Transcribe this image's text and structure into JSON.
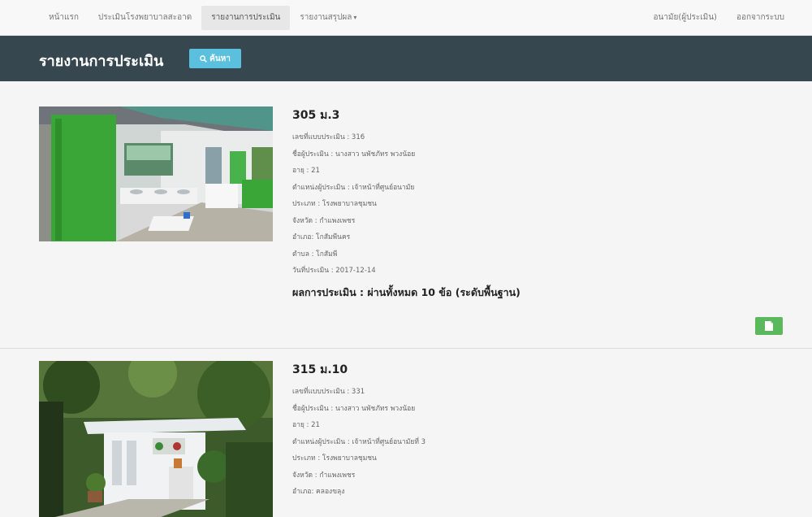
{
  "nav": {
    "home": "หน้าแรก",
    "assess": "ประเมินโรงพยาบาลสะอาด",
    "reports": "รายงานการประเมิน",
    "summary": "รายงานสรุปผล",
    "user": "อนามัย(ผู้ประเมิน)",
    "logout": "ออกจากระบบ"
  },
  "header": {
    "title": "รายงานการประเมิน",
    "search_label": "ค้นหา"
  },
  "records": [
    {
      "title": "305 ม.3",
      "form_no": "เลขที่แบบประเมิน : 316",
      "assessor": "ชื่อผู้ประเมิน : นางสาว นพัชภัทร พวงน้อย",
      "age": "อายุ : 21",
      "position": "ตำแหน่งผู้ประเมิน : เจ้าหน้าที่ศูนย์อนามัย",
      "type": "ประเภท : โรงพยาบาลชุมชน",
      "province": "จังหวัด : กำแพงเพชร",
      "district": "อำเภอ: โกสัมพีนคร",
      "subdistrict": "ตำบล : โกสัมพี",
      "date": "วันที่ประเมิน : 2017-12-14",
      "result": "ผลการประเมิน : ผ่านทั้งหมด 10 ข้อ (ระดับพื้นฐาน)"
    },
    {
      "title": "315 ม.10",
      "form_no": "เลขที่แบบประเมิน : 331",
      "assessor": "ชื่อผู้ประเมิน : นางสาว นพัชภัทร พวงน้อย",
      "age": "อายุ : 21",
      "position": "ตำแหน่งผู้ประเมิน : เจ้าหน้าที่ศูนย์อนามัยที่ 3",
      "type": "ประเภท : โรงพยาบาลชุมชน",
      "province": "จังหวัด : กำแพงเพชร",
      "district": "อำเภอ: คลองขลุง"
    }
  ],
  "colors": {
    "header_bg": "#37474f",
    "search_btn": "#5bc0de",
    "doc_btn": "#5cb85c"
  }
}
